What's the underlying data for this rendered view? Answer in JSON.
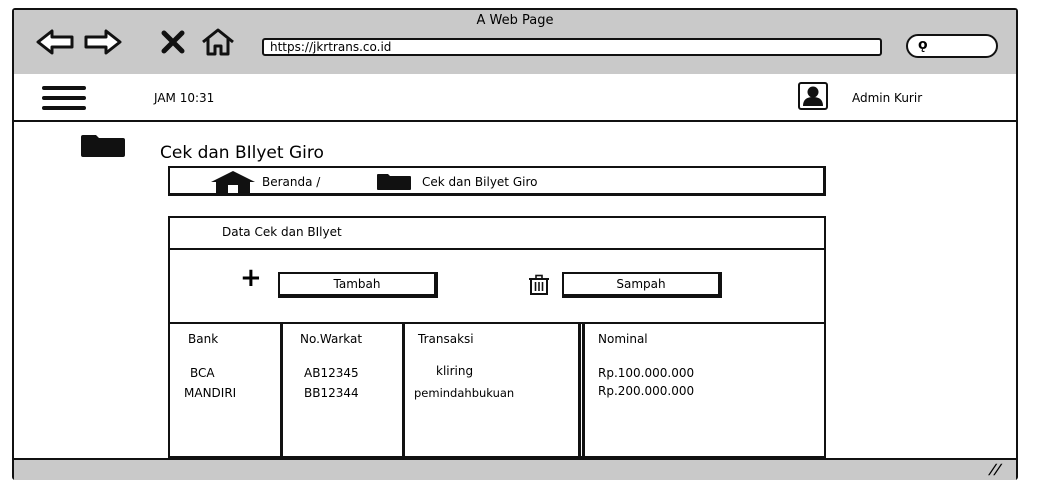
{
  "window": {
    "title": "A Web Page"
  },
  "browser": {
    "url": "https://jkrtrans.co.id"
  },
  "topbar": {
    "time": "JAM 10:31",
    "user": "Admin Kurir"
  },
  "page": {
    "title": "Cek dan BIlyet Giro"
  },
  "breadcrumb": {
    "home": "Beranda /",
    "current": "Cek dan Bilyet Giro"
  },
  "panel": {
    "title": "Data Cek dan BIlyet",
    "add_label": "Tambah",
    "trash_label": "Sampah"
  },
  "table": {
    "headers": [
      "Bank",
      "No.Warkat",
      "Transaksi",
      "Nominal"
    ],
    "rows": [
      [
        "BCA",
        "AB12345",
        "kliring",
        "Rp.100.000.000"
      ],
      [
        "MANDIRI",
        "BB12344",
        "pemindahbukuan",
        "Rp.200.000.000"
      ]
    ]
  }
}
